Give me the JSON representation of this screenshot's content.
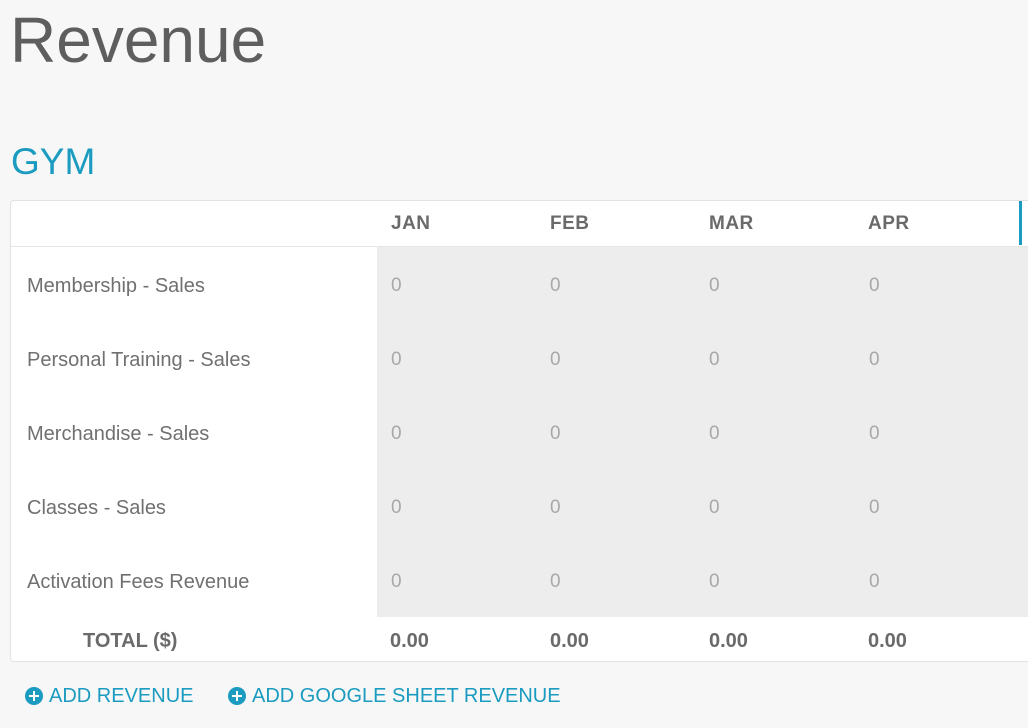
{
  "page": {
    "title": "Revenue"
  },
  "section": {
    "title": "GYM"
  },
  "table": {
    "columns": [
      "JAN",
      "FEB",
      "MAR",
      "APR"
    ],
    "rows": [
      {
        "label": "Membership - Sales",
        "values": [
          "0",
          "0",
          "0",
          "0"
        ]
      },
      {
        "label": "Personal Training - Sales",
        "values": [
          "0",
          "0",
          "0",
          "0"
        ]
      },
      {
        "label": "Merchandise - Sales",
        "values": [
          "0",
          "0",
          "0",
          "0"
        ]
      },
      {
        "label": "Classes - Sales",
        "values": [
          "0",
          "0",
          "0",
          "0"
        ]
      },
      {
        "label": "Activation Fees Revenue",
        "values": [
          "0",
          "0",
          "0",
          "0"
        ]
      }
    ],
    "total": {
      "label": "TOTAL ($)",
      "values": [
        "0.00",
        "0.00",
        "0.00",
        "0.00"
      ]
    }
  },
  "actions": {
    "add_revenue": "ADD REVENUE",
    "add_google_sheet_revenue": "ADD GOOGLE SHEET REVENUE"
  },
  "colors": {
    "accent": "#1a9bbf",
    "background": "#f7f7f7",
    "cell_background": "#ededed"
  },
  "icons": {
    "action_icon": "plus-circle-icon"
  }
}
